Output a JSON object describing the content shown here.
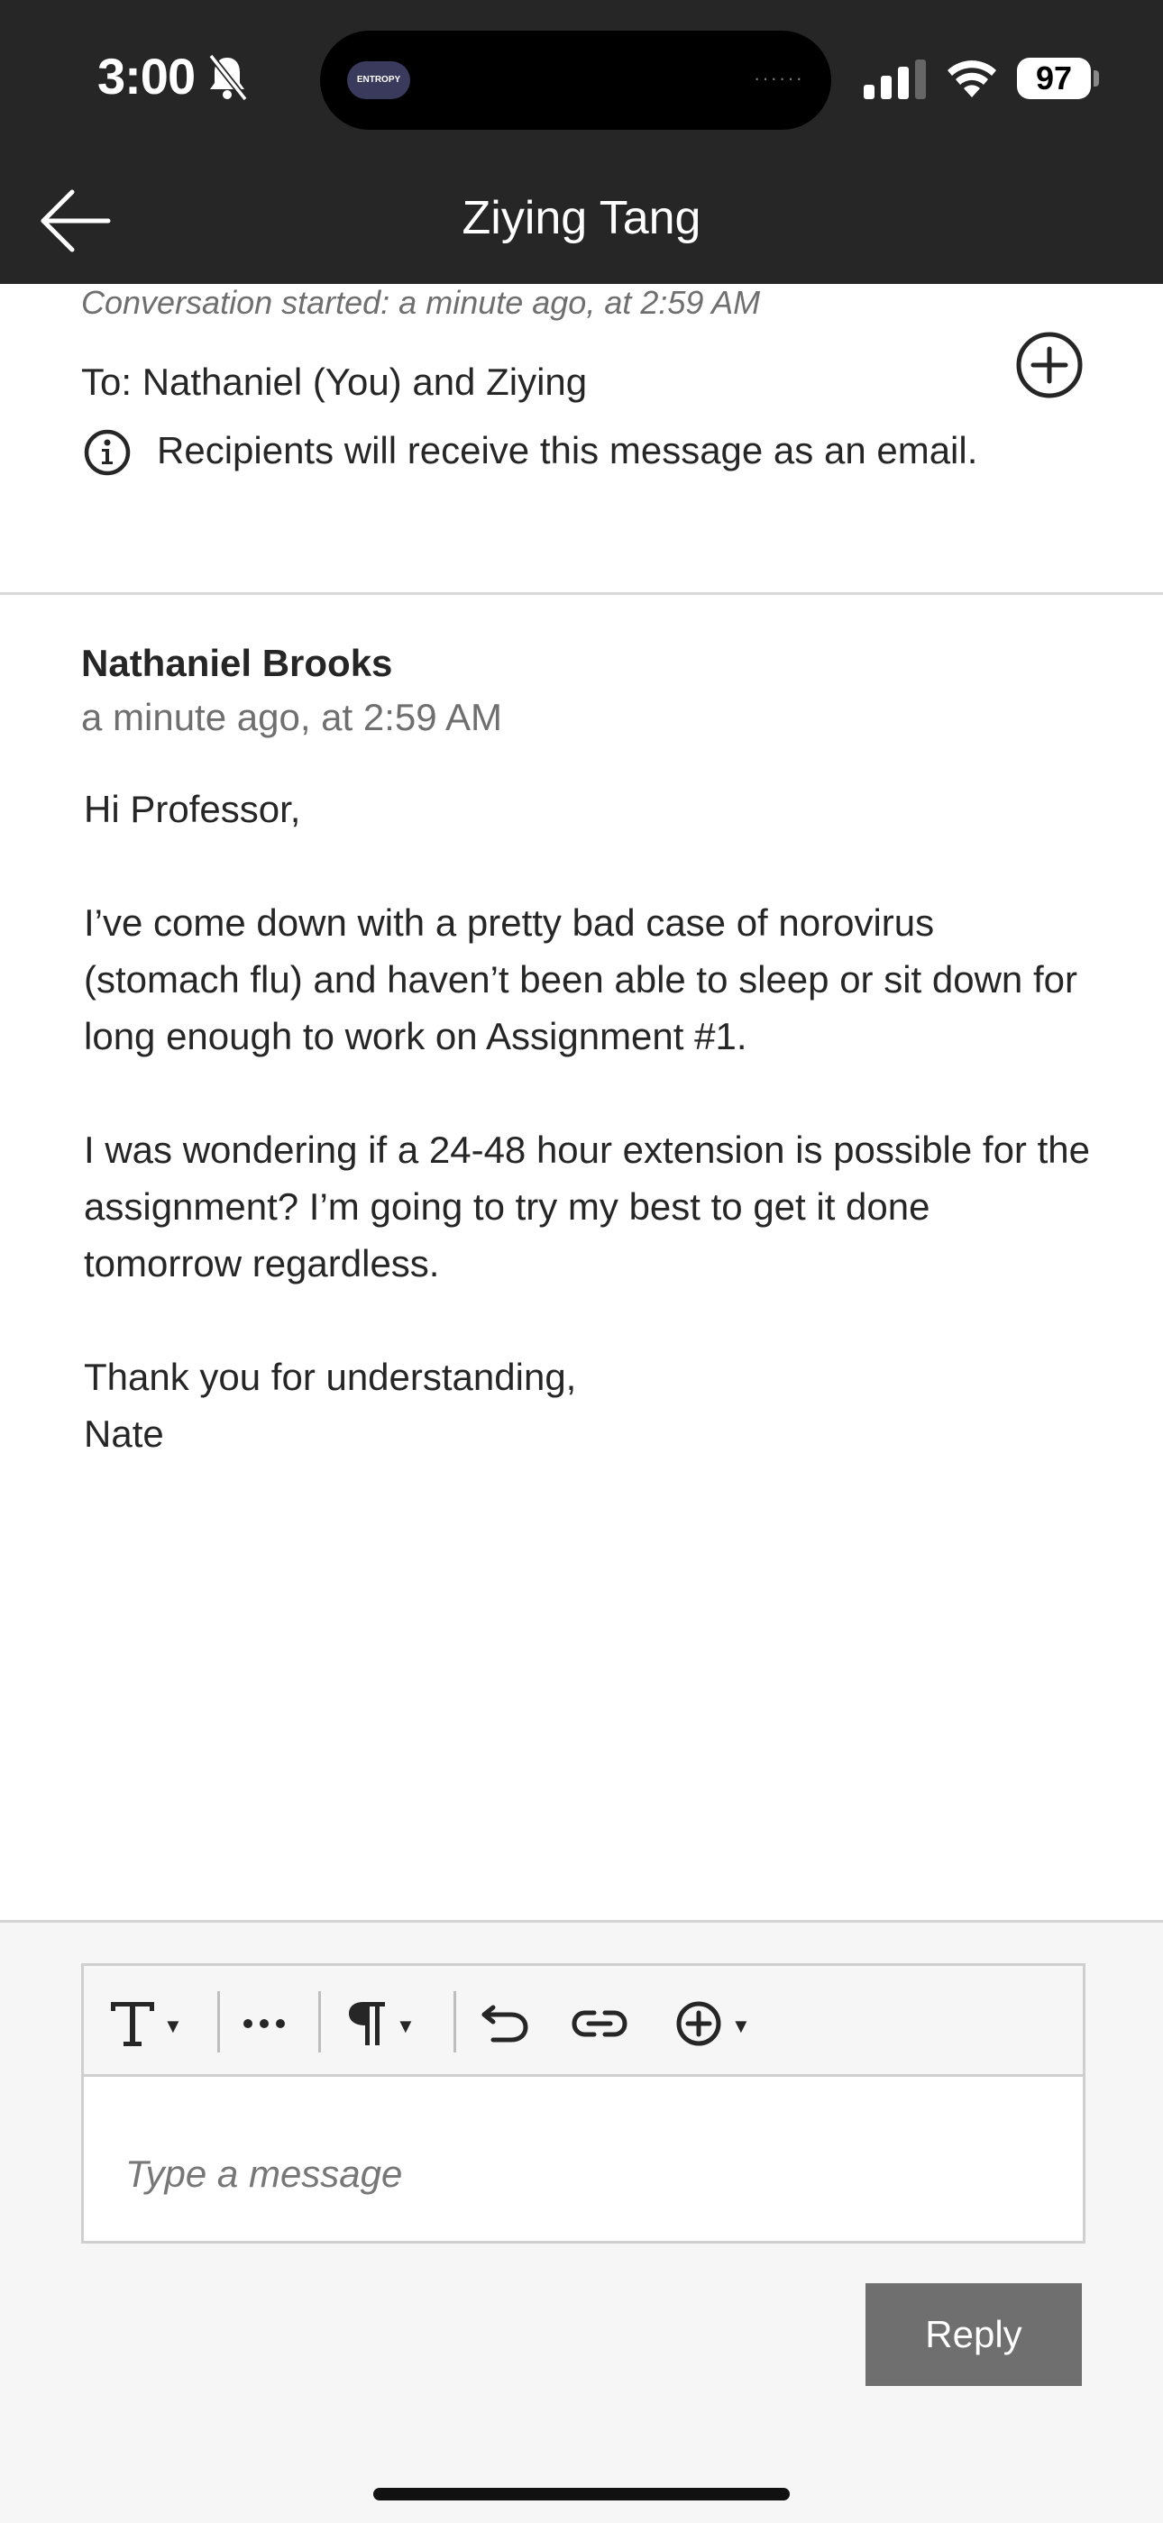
{
  "status_bar": {
    "time": "3:00",
    "island_badge": "ENTROPY",
    "battery": "97"
  },
  "nav": {
    "title": "Ziying Tang"
  },
  "conversation": {
    "started": "Conversation started: a minute ago, at 2:59 AM",
    "to": "To: Nathaniel (You) and Ziying",
    "recipients_note": "Recipients will receive this message as an email."
  },
  "message": {
    "sender": "Nathaniel Brooks",
    "time": "a minute ago, at 2:59 AM",
    "greeting": "Hi Professor,",
    "paragraph1": "I’ve come down with a pretty bad case of norovirus (stomach flu) and haven’t been able to sleep or sit down for long enough to work on Assignment #1.",
    "paragraph2": "I was wondering if a 24-48 hour extension is possible for the assignment? I’m going to try my best to get it done tomorrow regardless.",
    "closing": "Thank you for understanding,",
    "signature": "Nate"
  },
  "composer": {
    "placeholder": "Type a message",
    "reply_label": "Reply",
    "toolbar_icons": [
      "text-format-icon",
      "more-icon",
      "paragraph-icon",
      "undo-icon",
      "link-icon",
      "insert-icon"
    ]
  }
}
